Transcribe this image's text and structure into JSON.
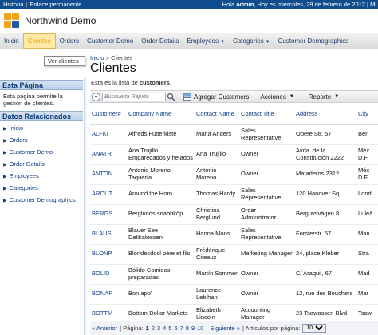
{
  "topbar": {
    "links": [
      "Historia",
      "Enlace permanente"
    ],
    "greeting_prefix": "Hola ",
    "user": "admin",
    "greeting_suffix": ", Hoy es miércoles, 29 de febrero de 2012 | Mi"
  },
  "app": {
    "title": "Northwind Demo"
  },
  "menu": [
    {
      "label": "Inicio",
      "caret": false
    },
    {
      "label": "Clientes",
      "caret": false,
      "active": true
    },
    {
      "label": "Orders",
      "caret": false
    },
    {
      "label": "Customer Demo",
      "caret": false
    },
    {
      "label": "Order Details",
      "caret": false
    },
    {
      "label": "Employees",
      "caret": true
    },
    {
      "label": "Categories",
      "caret": true
    },
    {
      "label": "Customer Demographics",
      "caret": false
    }
  ],
  "tooltip": "Ver clientes",
  "sidebar": {
    "page_heading": "Esta Página",
    "page_text": "Esta página permite la gestión de clientes.",
    "related_heading": "Datos Relacionados",
    "related": [
      "Inicio",
      "Orders",
      "Customer Demo",
      "Order Details",
      "Employees",
      "Categories",
      "Customer Demographics"
    ]
  },
  "breadcrumb": {
    "home": "Inicio",
    "sep": ">",
    "current": "Clientes"
  },
  "page": {
    "title": "Clientes",
    "desc_prefix": "Esta es la lista de ",
    "desc_bold": "customers",
    "desc_suffix": "."
  },
  "toolbar": {
    "search_placeholder": "Búsqueda Rápida",
    "add_label": "Agregar Customers",
    "actions_label": "Acciones",
    "report_label": "Reporte"
  },
  "grid": {
    "headers": [
      "Customer#",
      "Company Name",
      "Contact Name",
      "Contact Title",
      "Address",
      "City"
    ],
    "rows": [
      [
        "ALFKI",
        "Alfreds Futterkiste",
        "Maria Anders",
        "Sales Representative",
        "Obere Str. 57",
        "Berl"
      ],
      [
        "ANATR",
        "Ana Trujillo Emparedados y helados",
        "Ana Trujillo",
        "Owner",
        "Avda. de la Constitución 2222",
        "Méx D.F."
      ],
      [
        "ANTON",
        "Antonio Moreno Taquería",
        "Antonio Moreno",
        "Owner",
        "Mataderos 2312",
        "Méx D.F."
      ],
      [
        "AROUT",
        "Around the Horn",
        "Thomas Hardy",
        "Sales Representative",
        "120 Hanover Sq.",
        "Lond"
      ],
      [
        "BERGS",
        "Berglunds snabbköp",
        "Christina Berglund",
        "Order Administrator",
        "Berguvsvägen 8",
        "Luleå"
      ],
      [
        "BLAUS",
        "Blauer See Delikatessen",
        "Hanna Moos",
        "Sales Representative",
        "Forsterstr. 57",
        "Man"
      ],
      [
        "BLONP",
        "Blondesddsl père et fils",
        "Frédérique Citeaux",
        "Marketing Manager",
        "24, place Kléber",
        "Stra"
      ],
      [
        "BOLID",
        "Bólido Comidas preparadas",
        "Martín Sommer",
        "Owner",
        "C/ Araquil, 67",
        "Mad"
      ],
      [
        "BONAP",
        "Bon app'",
        "Laurence Lebihan",
        "Owner",
        "12, rue des Bouchers",
        "Mar"
      ],
      [
        "BOTTM",
        "Bottom-Dollar Markets",
        "Elizabeth Lincoln",
        "Accounting Manager",
        "23 Tsawassen Blvd.",
        "Tsaw"
      ]
    ]
  },
  "pager": {
    "prev": "« Anterior",
    "page_label": "| Página:",
    "pages": [
      "1",
      "2",
      "3",
      "4",
      "5",
      "6",
      "7",
      "8",
      "9",
      "10"
    ],
    "current": "1",
    "next": "Siguiente »",
    "per_page_label": "| Artículos por página:",
    "per_page": "10"
  },
  "colors": {
    "topbar": "#0f4d8f",
    "accent": "#e8a100",
    "link": "#0e3d85"
  }
}
